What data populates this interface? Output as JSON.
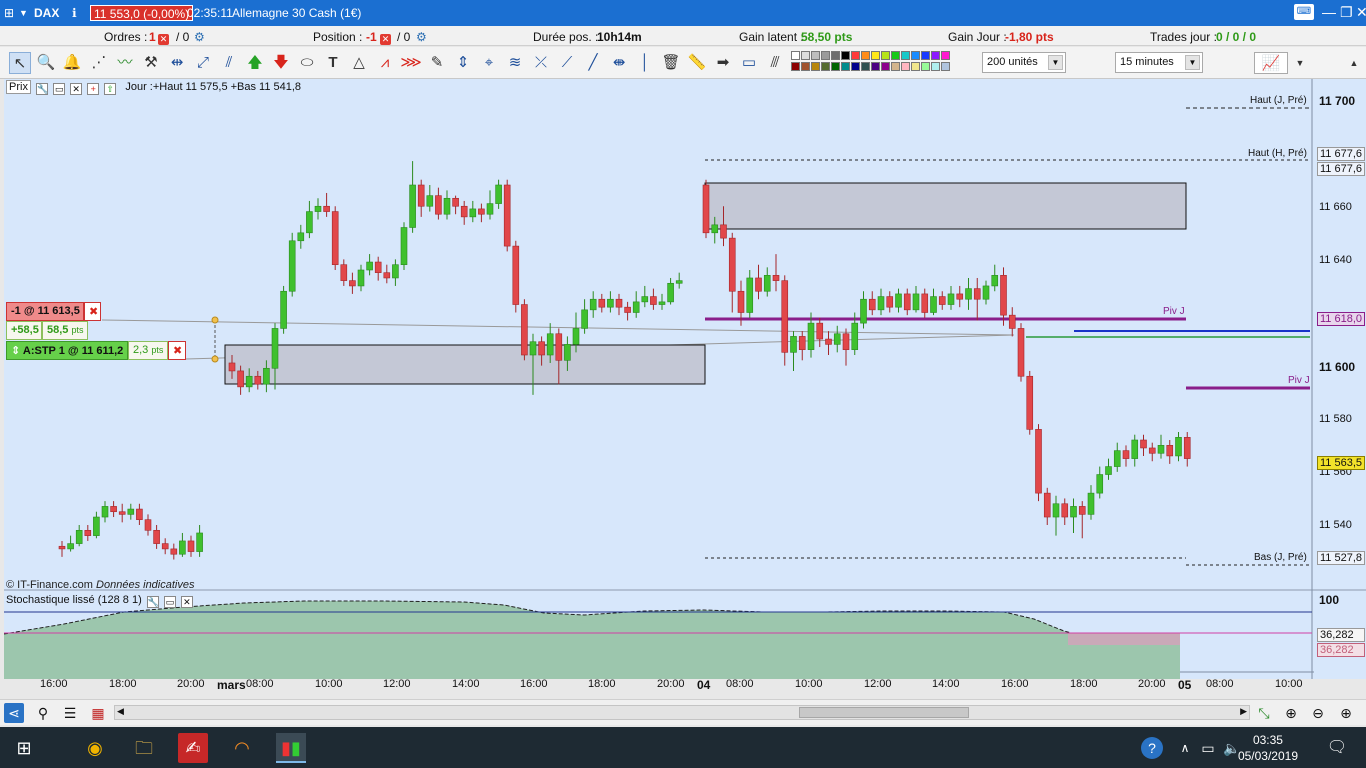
{
  "titlebar": {
    "instrument": "DAX",
    "price": "11 553,0 (-0,00%)",
    "time": "02:35:11",
    "product": "Allemagne 30 Cash (1€)",
    "win_min": "—",
    "win_restore": "❐",
    "win_close": "✕"
  },
  "positions": {
    "orders_label": "Ordres :",
    "orders_value": "1",
    "orders_other": "/ 0",
    "position_label": "Position :",
    "position_value": "-1",
    "position_other": "/ 0",
    "duration_label": "Durée pos. :",
    "duration_value": "10h14m",
    "latent_label": "Gain latent :",
    "latent_value": "58,50 pts",
    "day_label": "Gain Jour :",
    "day_value": "-1,80 pts",
    "trades_label": "Trades jour :",
    "trades_value": "0 / 0 / 0"
  },
  "toolbar": {
    "units": "200 unités",
    "timeframe": "15 minutes",
    "swatch_colors": [
      "#ffffff",
      "#dcdcdc",
      "#bdbdbd",
      "#9a9a9a",
      "#6e6e6e",
      "#000000",
      "#ff3b3b",
      "#ff8c1a",
      "#ffe81a",
      "#b6e51a",
      "#18c818",
      "#18c8c8",
      "#1a8cff",
      "#1a3bff",
      "#8c1aff",
      "#ff1ad1",
      "#8b0000",
      "#a0522d",
      "#b8860b",
      "#556b2f",
      "#006400",
      "#008b8b",
      "#00008b",
      "#2f4f4f",
      "#4b0082",
      "#8b008b",
      "#d2b48c",
      "#ffb6c1",
      "#f0e68c",
      "#98fb98",
      "#afeeee",
      "#b0c4de"
    ]
  },
  "chart": {
    "prix_label": "Prix",
    "day_info": "Jour :+Haut 11 575,5 +Bas 11 541,8",
    "sell_order": "-1 @ 11 613,5",
    "pnl_pts": "+58,5",
    "pnl_box": "58,5",
    "pnl_unit": "pts",
    "stop_order": "A:STP 1 @ 11 611,2",
    "stop_dist": "2,3",
    "stop_unit": "pts",
    "copyright": "© IT-Finance.com",
    "indicative": "Données indicatives",
    "stoch_label": "Stochastique lissé (128 8 1)",
    "levels": {
      "haut_j": "Haut (J, Pré)",
      "haut_h": "Haut (H, Pré)",
      "piv_j1": "Piv J",
      "piv_j2": "Piv J",
      "bas_j": "Bas (J, Pré)"
    },
    "yaxis": {
      "t11700": "11 700",
      "t11677a": "11 677,6",
      "t11677b": "11 677,6",
      "t11660": "11 660",
      "t11640": "11 640",
      "t11618": "11 618,0",
      "t11600": "11 600",
      "t11580": "11 580",
      "t11563": "11 563,5",
      "t11560": "11 560",
      "t11540": "11 540",
      "t11527": "11 527,8",
      "s100": "100",
      "s36a": "36,282",
      "s36b": "36,282"
    },
    "xaxis": [
      "16:00",
      "18:00",
      "20:00",
      "mars",
      "08:00",
      "10:00",
      "12:00",
      "14:00",
      "16:00",
      "18:00",
      "20:00",
      "04",
      "08:00",
      "10:00",
      "12:00",
      "14:00",
      "16:00",
      "18:00",
      "20:00",
      "05",
      "08:00",
      "10:00"
    ]
  },
  "taskbar": {
    "time": "03:35",
    "date": "05/03/2019"
  }
}
